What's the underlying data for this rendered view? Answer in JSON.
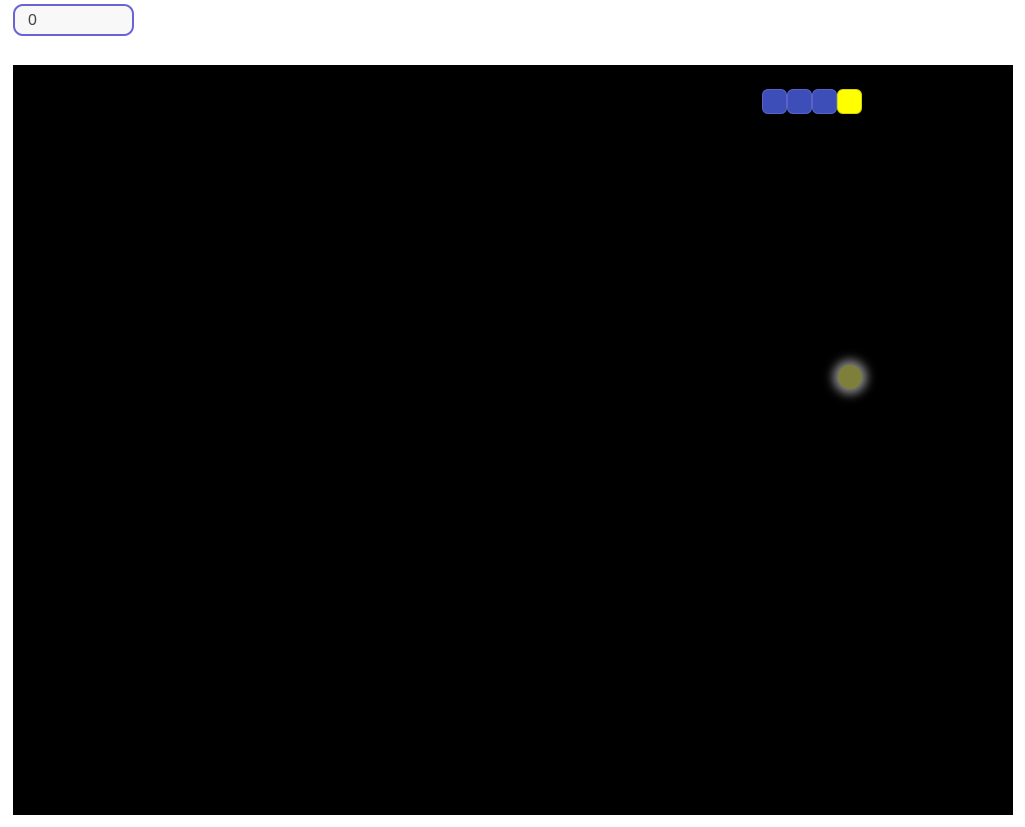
{
  "score": {
    "value": "0"
  },
  "game": {
    "colors": {
      "board": "#000000",
      "snake_body": "#3e4eb8",
      "snake_head": "#ffff00",
      "food": "#7d7f3a",
      "score_border": "#6a63d6"
    },
    "snake": {
      "length": 4,
      "segment_types": [
        "body",
        "body",
        "body",
        "head"
      ]
    },
    "food_count": 1
  }
}
